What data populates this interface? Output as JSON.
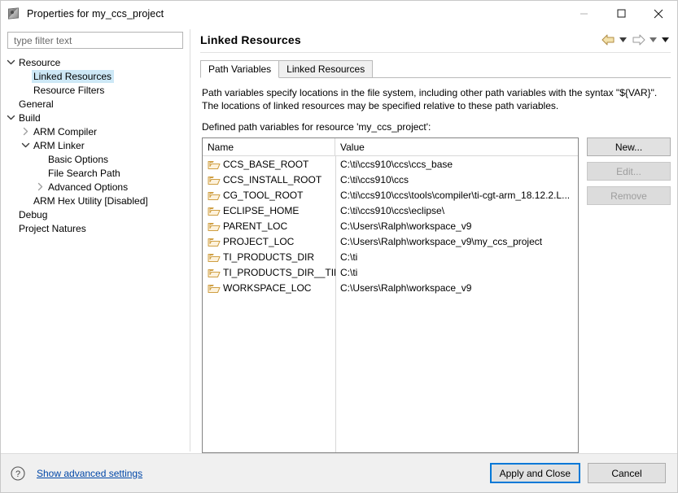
{
  "window": {
    "title": "Properties for my_ccs_project",
    "icon": "app-cube-icon",
    "minimize_label": "Minimize",
    "maximize_label": "Maximize",
    "close_label": "Close"
  },
  "filter": {
    "placeholder": "type filter text",
    "value": ""
  },
  "tree": {
    "items": [
      {
        "label": "Resource",
        "indent": 0,
        "twisty": "expanded",
        "selected": false
      },
      {
        "label": "Linked Resources",
        "indent": 1,
        "twisty": "none",
        "selected": true
      },
      {
        "label": "Resource Filters",
        "indent": 1,
        "twisty": "none",
        "selected": false
      },
      {
        "label": "General",
        "indent": 0,
        "twisty": "none",
        "selected": false
      },
      {
        "label": "Build",
        "indent": 0,
        "twisty": "expanded",
        "selected": false
      },
      {
        "label": "ARM Compiler",
        "indent": 1,
        "twisty": "collapsed",
        "selected": false
      },
      {
        "label": "ARM Linker",
        "indent": 1,
        "twisty": "expanded",
        "selected": false
      },
      {
        "label": "Basic Options",
        "indent": 2,
        "twisty": "none",
        "selected": false
      },
      {
        "label": "File Search Path",
        "indent": 2,
        "twisty": "none",
        "selected": false
      },
      {
        "label": "Advanced Options",
        "indent": 2,
        "twisty": "collapsed",
        "selected": false
      },
      {
        "label": "ARM Hex Utility  [Disabled]",
        "indent": 1,
        "twisty": "none",
        "selected": false
      },
      {
        "label": "Debug",
        "indent": 0,
        "twisty": "none",
        "selected": false
      },
      {
        "label": "Project Natures",
        "indent": 0,
        "twisty": "none",
        "selected": false
      }
    ]
  },
  "page": {
    "title": "Linked Resources",
    "nav": {
      "back_label": "Back",
      "back_menu_label": "Back history",
      "forward_label": "Forward",
      "forward_menu_label": "Forward history",
      "menu_label": "View menu"
    }
  },
  "tabs": [
    {
      "label": "Path Variables",
      "active": true
    },
    {
      "label": "Linked Resources",
      "active": false
    }
  ],
  "description": {
    "line1": "Path variables specify locations in the file system, including other path variables with the syntax \"${VAR}\".",
    "line2": "The locations of linked resources may be specified relative to these path variables.",
    "line3": "Defined path variables for resource 'my_ccs_project':"
  },
  "table": {
    "columns": [
      "Name",
      "Value"
    ],
    "rows": [
      {
        "name": "CCS_BASE_ROOT",
        "value": "C:\\ti\\ccs910\\ccs\\ccs_base"
      },
      {
        "name": "CCS_INSTALL_ROOT",
        "value": "C:\\ti\\ccs910\\ccs"
      },
      {
        "name": "CG_TOOL_ROOT",
        "value": "C:\\ti\\ccs910\\ccs\\tools\\compiler\\ti-cgt-arm_18.12.2.L..."
      },
      {
        "name": "ECLIPSE_HOME",
        "value": "C:\\ti\\ccs910\\ccs\\eclipse\\"
      },
      {
        "name": "PARENT_LOC",
        "value": "C:\\Users\\Ralph\\workspace_v9"
      },
      {
        "name": "PROJECT_LOC",
        "value": "C:\\Users\\Ralph\\workspace_v9\\my_ccs_project"
      },
      {
        "name": "TI_PRODUCTS_DIR",
        "value": "C:\\ti"
      },
      {
        "name": "TI_PRODUCTS_DIR__TIREX",
        "value": "C:\\ti"
      },
      {
        "name": "WORKSPACE_LOC",
        "value": "C:\\Users\\Ralph\\workspace_v9"
      }
    ]
  },
  "side_buttons": [
    {
      "label": "New...",
      "enabled": true
    },
    {
      "label": "Edit...",
      "enabled": false
    },
    {
      "label": "Remove",
      "enabled": false
    }
  ],
  "footer": {
    "help_icon": "help-icon",
    "advanced_link": "Show advanced settings",
    "apply_label": "Apply and Close",
    "cancel_label": "Cancel"
  },
  "colors": {
    "selection": "#cde8f6",
    "link": "#0047a8",
    "default_button_border": "#0078d7",
    "folder_icon": "#d9a441"
  }
}
